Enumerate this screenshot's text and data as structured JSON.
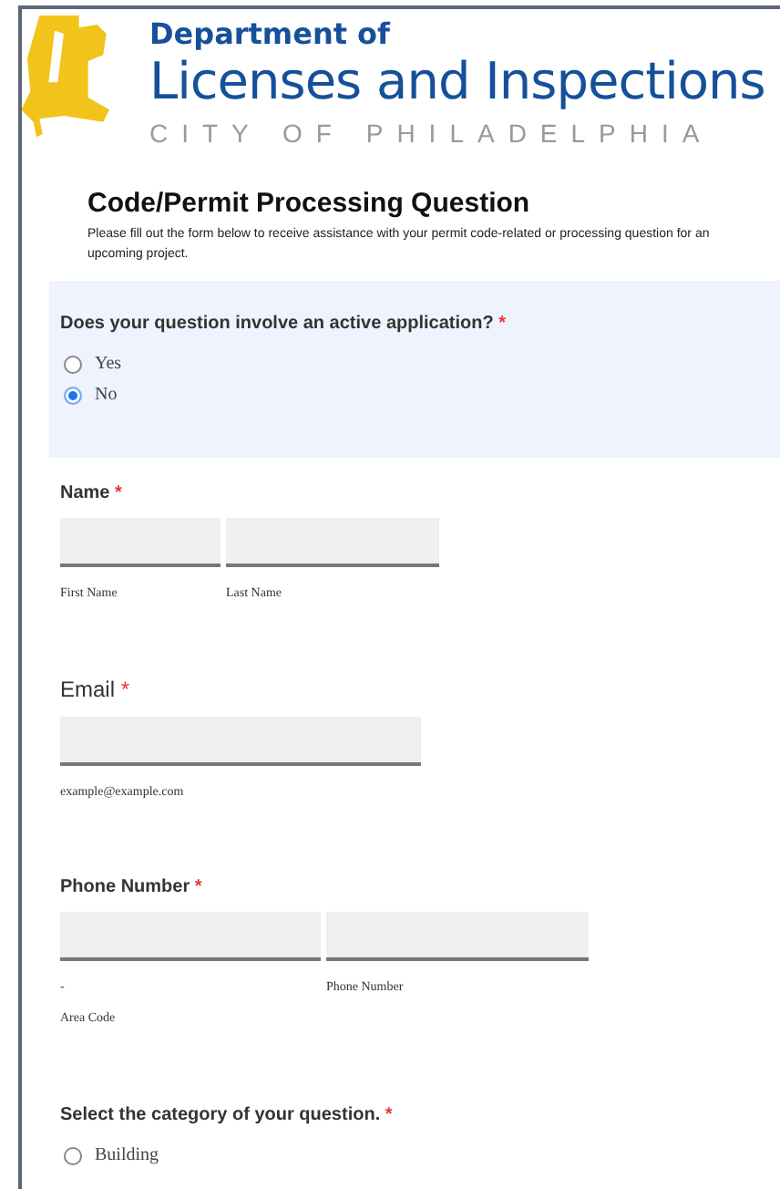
{
  "header": {
    "line1": "Department of",
    "line2": "Licenses and Inspections",
    "line3": "CITY OF PHILADELPHIA"
  },
  "form": {
    "title": "Code/Permit Processing Question",
    "description": "Please fill out the form below to receive assistance with your permit code-related or processing question for an upcoming project."
  },
  "questions": [
    {
      "kind": "radio",
      "label": "Does your question involve an active application?",
      "required_mark": "*",
      "highlighted": true,
      "options": [
        {
          "label": "Yes",
          "selected": false
        },
        {
          "label": "No",
          "selected": true
        }
      ]
    },
    {
      "kind": "name",
      "label": "Name",
      "required_mark": "*",
      "highlighted": false,
      "inputs": [
        {
          "notes": [
            "First Name"
          ]
        },
        {
          "notes": [
            "Last Name"
          ]
        }
      ]
    },
    {
      "kind": "email",
      "label": "Email",
      "required_mark": "*",
      "highlighted": false,
      "inputs": [
        {
          "notes": [
            "example@example.com"
          ]
        }
      ]
    },
    {
      "kind": "phone",
      "label": "Phone Number",
      "required_mark": "*",
      "highlighted": false,
      "inputs": [
        {
          "notes": [
            "-",
            "Area Code"
          ]
        },
        {
          "notes": [
            "Phone Number"
          ]
        }
      ]
    },
    {
      "kind": "radio",
      "label": "Select the category of your question.",
      "required_mark": "*",
      "highlighted": false,
      "options": [
        {
          "label": "Building",
          "selected": false
        }
      ]
    }
  ]
}
